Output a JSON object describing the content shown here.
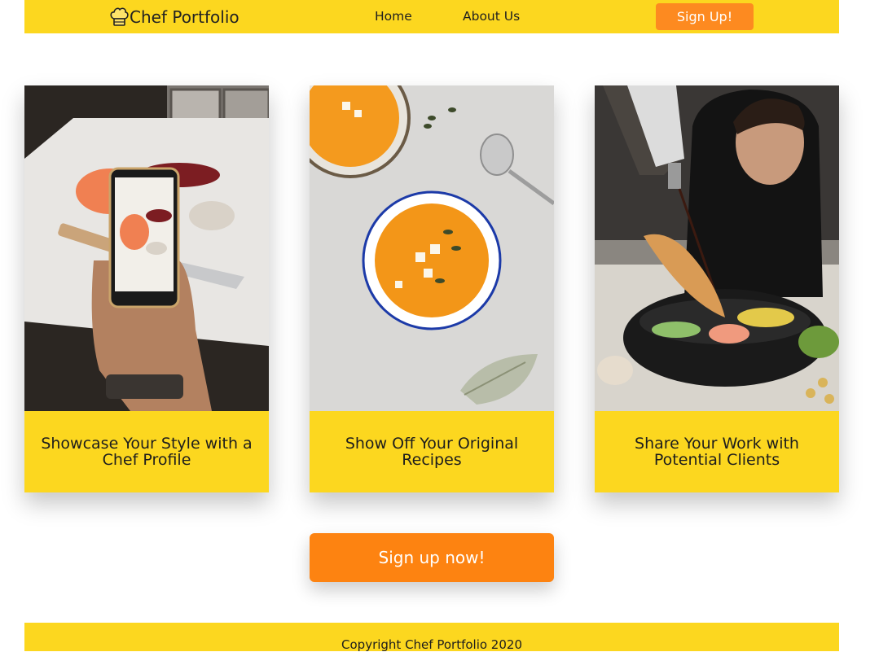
{
  "nav": {
    "brand_label": "Chef Portfolio",
    "brand_icon": "chef-hat-icon",
    "home_label": "Home",
    "about_label": "About Us",
    "signup_label": "Sign Up!"
  },
  "cards": [
    {
      "caption": "Showcase Your Style with a Chef Profile",
      "image": "phone-photographing-food"
    },
    {
      "caption": "Show Off Your Original Recipes",
      "image": "pumpkin-soup-bowl"
    },
    {
      "caption": "Share Your Work with Potential Clients",
      "image": "chef-plating-bowl"
    }
  ],
  "cta": {
    "label": "Sign up now!"
  },
  "footer": {
    "copyright": "Copyright Chef Portfolio 2020"
  },
  "colors": {
    "brand_yellow": "#fcd71f",
    "accent_orange": "#fd8311",
    "text_dark": "#1d1d1d"
  }
}
